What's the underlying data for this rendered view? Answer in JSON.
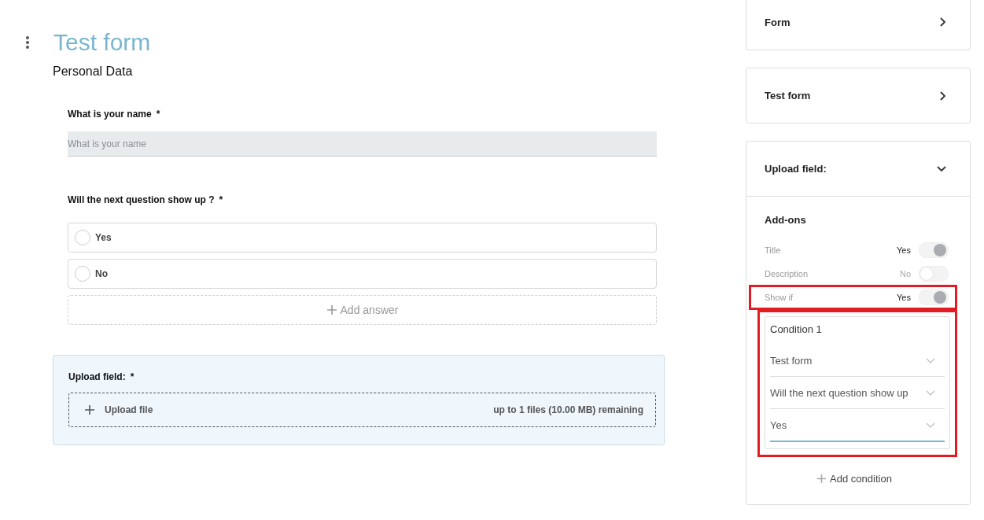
{
  "form": {
    "title": "Test form",
    "section": "Personal Data",
    "questions": [
      {
        "kind": "text",
        "label": "What is your name",
        "required": "*",
        "placeholder": "What is your name"
      },
      {
        "kind": "choice",
        "label": "Will the next question show up ?",
        "required": "*",
        "options": [
          {
            "label": "Yes",
            "selected": false
          },
          {
            "label": "No",
            "selected": false
          }
        ],
        "add_label": "Add answer"
      },
      {
        "kind": "upload",
        "label": "Upload field:",
        "required": "*",
        "selected": true,
        "button": "Upload file",
        "note": "up to 1 files (10.00 MB) remaining"
      }
    ]
  },
  "sidebar": {
    "cards": [
      {
        "title": "Form",
        "expanded": false
      },
      {
        "title": "Test form",
        "expanded": false
      },
      {
        "title": "Upload field:",
        "expanded": true,
        "addons_title": "Add-ons",
        "addons": [
          {
            "label": "Title",
            "value": "Yes",
            "on": true,
            "highlighted": false
          },
          {
            "label": "Description",
            "value": "No",
            "on": false,
            "highlighted": false
          },
          {
            "label": "Show if",
            "value": "Yes",
            "on": true,
            "highlighted": true
          }
        ],
        "conditions": [
          {
            "title": "Condition 1",
            "highlighted": true,
            "selects": [
              {
                "value": "Test form",
                "focused": false
              },
              {
                "value": "Will the next question show up",
                "focused": false
              },
              {
                "value": "Yes",
                "focused": true
              }
            ]
          }
        ],
        "add_condition": "Add condition"
      }
    ]
  }
}
